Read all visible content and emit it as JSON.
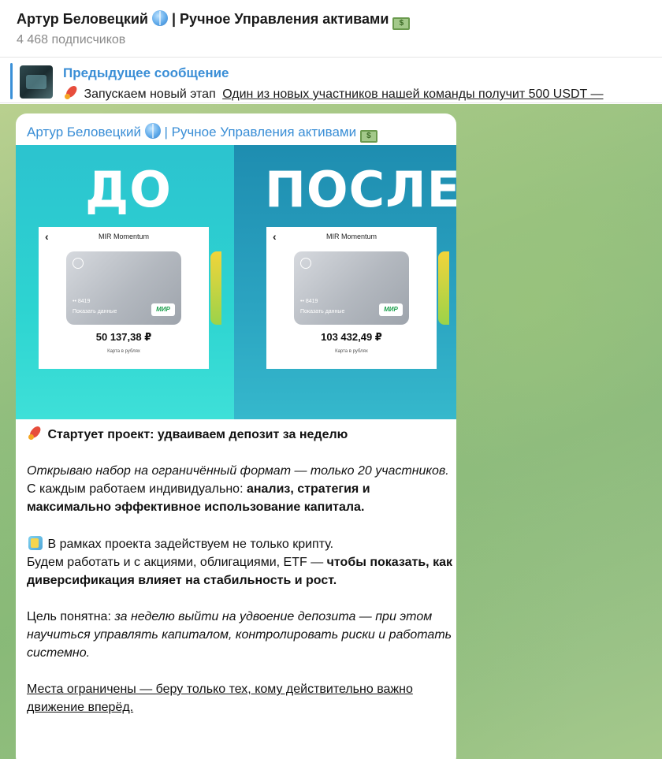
{
  "header": {
    "title_name": "Артур Беловецкий",
    "title_channel": "| Ручное Управления активами",
    "subscribers": "4 468 подписчиков"
  },
  "icons": {
    "globe": "globe-icon",
    "money": "money-icon",
    "rocket": "rocket-icon",
    "chart": "chart-icon"
  },
  "pinned": {
    "label": "Предыдущее сообщение",
    "text_start": "Запускаем новый этап",
    "text_link": "Один из новых участников нашей команды получит 500 USDT —"
  },
  "message": {
    "author_name": "Артур Беловецкий",
    "author_channel": "| Ручное Управления активами",
    "image": {
      "before_label": "ДО",
      "after_label": "ПОСЛЕ",
      "card_title": "MIR Momentum",
      "card_number": "•• 8419",
      "card_show": "Показать данные",
      "card_brand": "МИР",
      "card_currency_note": "Карта в рублях",
      "balance_before": "50 137,38 ₽",
      "balance_after": "103 432,49 ₽"
    },
    "p1": "Стартует проект: удваиваем депозит за неделю",
    "p2_italic": "Открываю набор на ограничённый формат — только 20 участников.",
    "p3_start": "С каждым работаем индивидуально: ",
    "p3_bold": "анализ, стратегия и максимально эффективное использование капитала.",
    "p4_line1": "В рамках проекта задействуем не только крипту.",
    "p4_start": "Будем работать и с акциями, облигациями, ETF — ",
    "p4_bold": "чтобы показать, как диверсификация влияет на стабильность и рост.",
    "p5_start": "Цель понятна: ",
    "p5_italic": "за неделю выйти на удвоение депозита — при этом научиться управлять капиталом, контролировать риски и работать системно.",
    "p6_underline": "Места ограничены — беру только тех, кому действительно важно движение вперёд."
  }
}
